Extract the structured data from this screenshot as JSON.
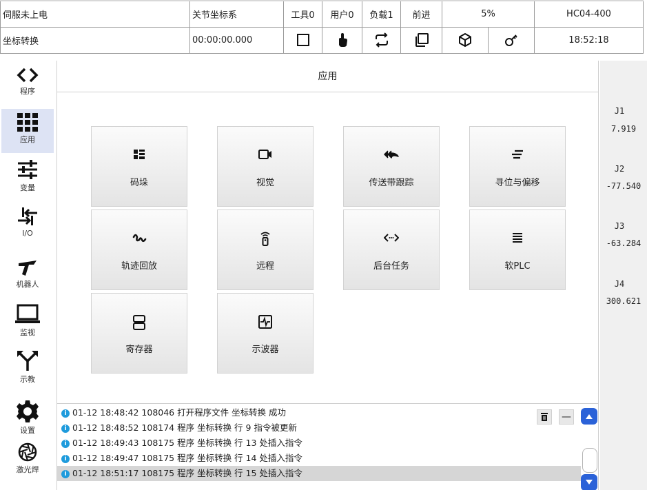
{
  "status": {
    "row1": {
      "servo": "伺服未上电",
      "coord_system": "关节坐标系",
      "tool": "工具0",
      "user": "用户0",
      "load": "负载1",
      "direction": "前进",
      "speed": "5%",
      "model": "HC04-400"
    },
    "row2": {
      "program": "坐标转换",
      "runtime": "00:00:00.000",
      "clock": "18:52:18"
    },
    "icons": [
      "square-icon",
      "hand-pointer-icon",
      "repeat-icon",
      "copy-icon",
      "cube-icon",
      "key-icon"
    ]
  },
  "sidebar": {
    "items": [
      {
        "label": "程序",
        "icon": "code-brackets-icon"
      },
      {
        "label": "应用",
        "icon": "grid-icon",
        "active": true
      },
      {
        "label": "变量",
        "icon": "sliders-icon"
      },
      {
        "label": "I/O",
        "icon": "io-arrows-icon"
      },
      {
        "label": "机器人",
        "icon": "robot-arm-icon"
      },
      {
        "label": "监视",
        "icon": "laptop-icon"
      },
      {
        "label": "示教",
        "icon": "teach-arrows-icon"
      },
      {
        "label": "设置",
        "icon": "gear-icon"
      },
      {
        "label": "激光焊",
        "icon": "aperture-icon"
      }
    ]
  },
  "main": {
    "title": "应用",
    "tiles": [
      {
        "label": "码垛",
        "icon": "palletize-icon"
      },
      {
        "label": "视觉",
        "icon": "camera-icon"
      },
      {
        "label": "传送带跟踪",
        "icon": "reply-all-icon"
      },
      {
        "label": "寻位与偏移",
        "icon": "align-lines-icon"
      },
      {
        "label": "轨迹回放",
        "icon": "squiggle-path-icon"
      },
      {
        "label": "远程",
        "icon": "remote-icon"
      },
      {
        "label": "后台任务",
        "icon": "code-dots-icon"
      },
      {
        "label": "软PLC",
        "icon": "list-lines-icon"
      },
      {
        "label": "寄存器",
        "icon": "storage-icon"
      },
      {
        "label": "示波器",
        "icon": "oscilloscope-icon"
      }
    ]
  },
  "log": {
    "entries": [
      "01-12 18:48:42 108046 打开程序文件 坐标转换 成功",
      "01-12 18:48:52 108174 程序 坐标转换 行 9 指令被更新",
      "01-12 18:49:43 108175 程序 坐标转换 行 13 处插入指令",
      "01-12 18:49:47 108175 程序 坐标转换 行 14 处插入指令",
      "01-12 18:51:17 108175 程序 坐标转换 行 15 处插入指令"
    ],
    "selected_index": 4,
    "info_glyph": "i",
    "collapse_glyph": "—"
  },
  "joints": [
    {
      "name": "J1",
      "value": "7.919"
    },
    {
      "name": "J2",
      "value": "-77.540"
    },
    {
      "name": "J3",
      "value": "-63.284"
    },
    {
      "name": "J4",
      "value": "300.621"
    }
  ],
  "colors": {
    "accent": "#2b62d8",
    "info": "#1e9bdc",
    "active_nav": "#dde3f4"
  }
}
